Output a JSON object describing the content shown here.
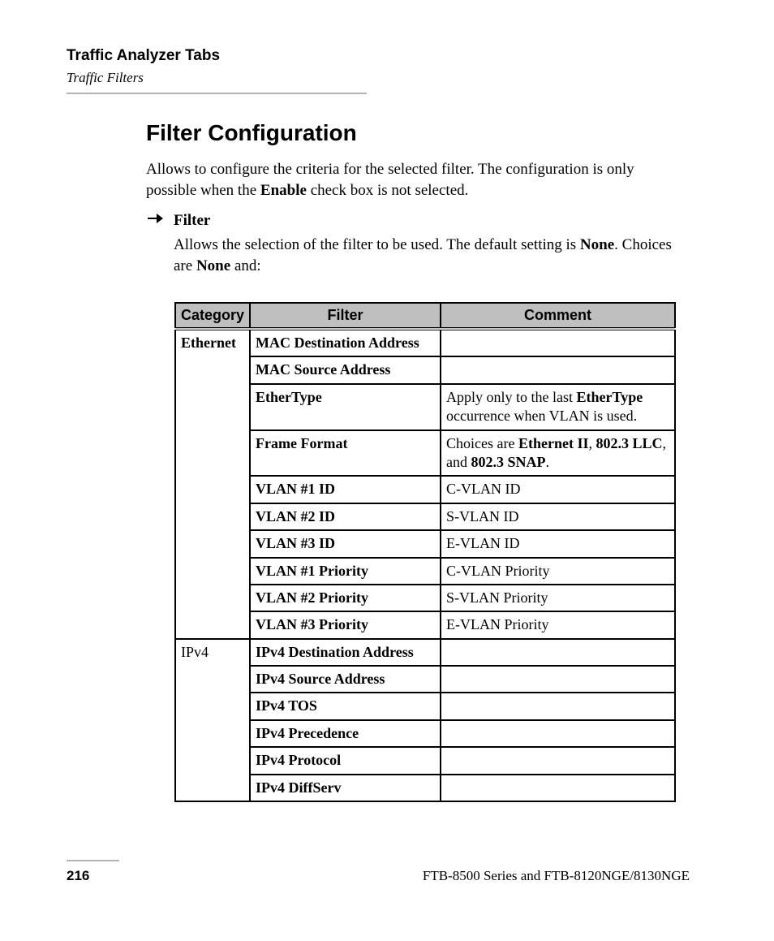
{
  "header": {
    "title": "Traffic Analyzer Tabs",
    "subtitle": "Traffic Filters"
  },
  "section": {
    "heading": "Filter Configuration",
    "intro_pre": "Allows to configure the criteria for the selected filter. The configuration is only possible when the ",
    "intro_bold": "Enable",
    "intro_post": " check box is not selected.",
    "bullet_label": "Filter",
    "bullet_body_pre": "Allows the selection of the filter to be used. The default setting is ",
    "bullet_body_bold1": "None",
    "bullet_body_mid": ". Choices are ",
    "bullet_body_bold2": "None",
    "bullet_body_post": " and:"
  },
  "table": {
    "headers": {
      "c1": "Category",
      "c2": "Filter",
      "c3": "Comment"
    },
    "rows": [
      {
        "category": "Ethernet",
        "category_rowspan": 9,
        "category_bold": true,
        "filter": "MAC Destination Address",
        "comment_parts": []
      },
      {
        "filter": "MAC Source Address",
        "comment_parts": []
      },
      {
        "filter": "EtherType",
        "comment_parts": [
          {
            "t": "Apply only to the last ",
            "b": false
          },
          {
            "t": "EtherType",
            "b": true
          },
          {
            "t": " occurrence when VLAN is used.",
            "b": false
          }
        ]
      },
      {
        "filter": "Frame Format",
        "comment_parts": [
          {
            "t": "Choices are ",
            "b": false
          },
          {
            "t": "Ethernet II",
            "b": true
          },
          {
            "t": ", ",
            "b": false
          },
          {
            "t": "802.3 LLC",
            "b": true
          },
          {
            "t": ", and ",
            "b": false
          },
          {
            "t": "802.3 SNAP",
            "b": true
          },
          {
            "t": ".",
            "b": false
          }
        ]
      },
      {
        "filter": "VLAN #1 ID",
        "comment_parts": [
          {
            "t": "C-VLAN ID",
            "b": false
          }
        ]
      },
      {
        "filter": "VLAN #2 ID",
        "comment_parts": [
          {
            "t": "S-VLAN ID",
            "b": false
          }
        ]
      },
      {
        "filter": "VLAN #3 ID",
        "comment_parts": [
          {
            "t": "E-VLAN ID",
            "b": false
          }
        ]
      },
      {
        "filter": "VLAN #1 Priority",
        "comment_parts": [
          {
            "t": "C-VLAN Priority",
            "b": false
          }
        ]
      },
      {
        "filter": "VLAN #2 Priority",
        "comment_parts": [
          {
            "t": "S-VLAN Priority",
            "b": false
          }
        ]
      },
      {
        "filter": "VLAN #3 Priority",
        "comment_parts": [
          {
            "t": "E-VLAN Priority",
            "b": false
          }
        ],
        "extra_category": "",
        "skip_cat": true
      },
      {
        "category": "IPv4",
        "category_rowspan": 6,
        "category_bold": false,
        "filter": "IPv4 Destination Address",
        "comment_parts": []
      },
      {
        "filter": "IPv4 Source Address",
        "comment_parts": []
      },
      {
        "filter": "IPv4 TOS",
        "comment_parts": []
      },
      {
        "filter": "IPv4 Precedence",
        "comment_parts": []
      },
      {
        "filter": "IPv4 Protocol",
        "comment_parts": []
      },
      {
        "filter": "IPv4 DiffServ",
        "comment_parts": []
      }
    ]
  },
  "footer": {
    "page": "216",
    "right": "FTB-8500 Series and FTB-8120NGE/8130NGE"
  }
}
